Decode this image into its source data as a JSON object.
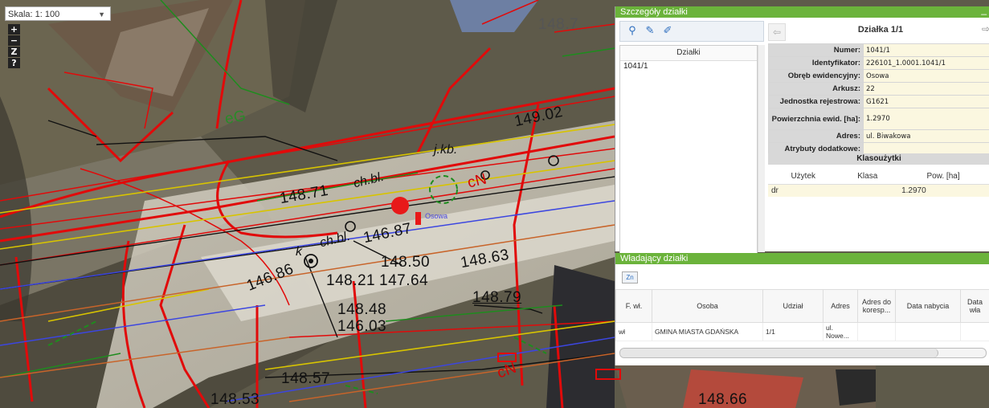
{
  "map": {
    "scale_label": "Skala: 1: 100",
    "zoom_buttons": [
      "+",
      "−",
      "Z",
      "?"
    ],
    "labels": {
      "elev_14871": "148.71",
      "elev_14687": "146.87",
      "elev_14850": "148.50",
      "elev_14863": "148.63",
      "elev_14821": "148.21",
      "elev_14764": "147.64",
      "elev_14686": "146.86",
      "elev_14879": "148.79",
      "elev_14848": "148.48",
      "elev_14603": "146.03",
      "elev_14857": "148.57",
      "elev_14853": "148.53",
      "elev_14866": "148.66",
      "elev_14902": "149.02",
      "elev_1487": "148.7",
      "chbl": "ch.bl.",
      "chbl2": "ch.bl.",
      "jkb": "j.kb.",
      "k": "k",
      "osowa": "Osowa",
      "cn1": "cN",
      "cn2": "cN",
      "eg": "eG"
    },
    "colors": {
      "red": "#e10a0a",
      "green": "#1e8c1e",
      "blue": "#3c46e0",
      "yellow": "#d8c400",
      "orange": "#c8642a"
    }
  },
  "details_panel": {
    "title": "Szczegóły działki",
    "minimize": "_",
    "parcel_list_header": "Działki",
    "parcel_items": [
      "1041/1"
    ],
    "nav_title": "Działka 1/1",
    "attributes": [
      {
        "key": "Numer:",
        "value": "1041/1"
      },
      {
        "key": "Identyfikator:",
        "value": "226101_1.0001.1041/1"
      },
      {
        "key": "Obręb ewidencyjny:",
        "value": "Osowa"
      },
      {
        "key": "Arkusz:",
        "value": "22"
      },
      {
        "key": "Jednostka rejestrowa:",
        "value": "G1621"
      },
      {
        "key": "Powierzchnia ewid. [ha]:",
        "value": "1.2970"
      },
      {
        "key": "Adres:",
        "value": "ul. Biwakowa"
      },
      {
        "key": "Atrybuty dodatkowe:",
        "value": ""
      }
    ],
    "land_use": {
      "header": "Klasoużytki",
      "columns": [
        "Użytek",
        "Klasa",
        "Pow. [ha]"
      ],
      "rows": [
        {
          "uzytek": "dr",
          "klasa": "",
          "pow": "1.2970"
        }
      ]
    }
  },
  "owners_panel": {
    "title": "Władający działki",
    "toolbar_icon_label": "Zn",
    "columns": [
      "F. wł.",
      "Osoba",
      "Udział",
      "Adres",
      "Adres do koresp...",
      "Data nabycia",
      "Data wła"
    ],
    "rows": [
      {
        "fwl": "wł",
        "osoba": "GMINA MIASTA GDAŃSKA",
        "udzial": "1/1",
        "adres": "ul. Nowe...",
        "koresp": "",
        "nabycia": "",
        "wlad": ""
      }
    ]
  }
}
